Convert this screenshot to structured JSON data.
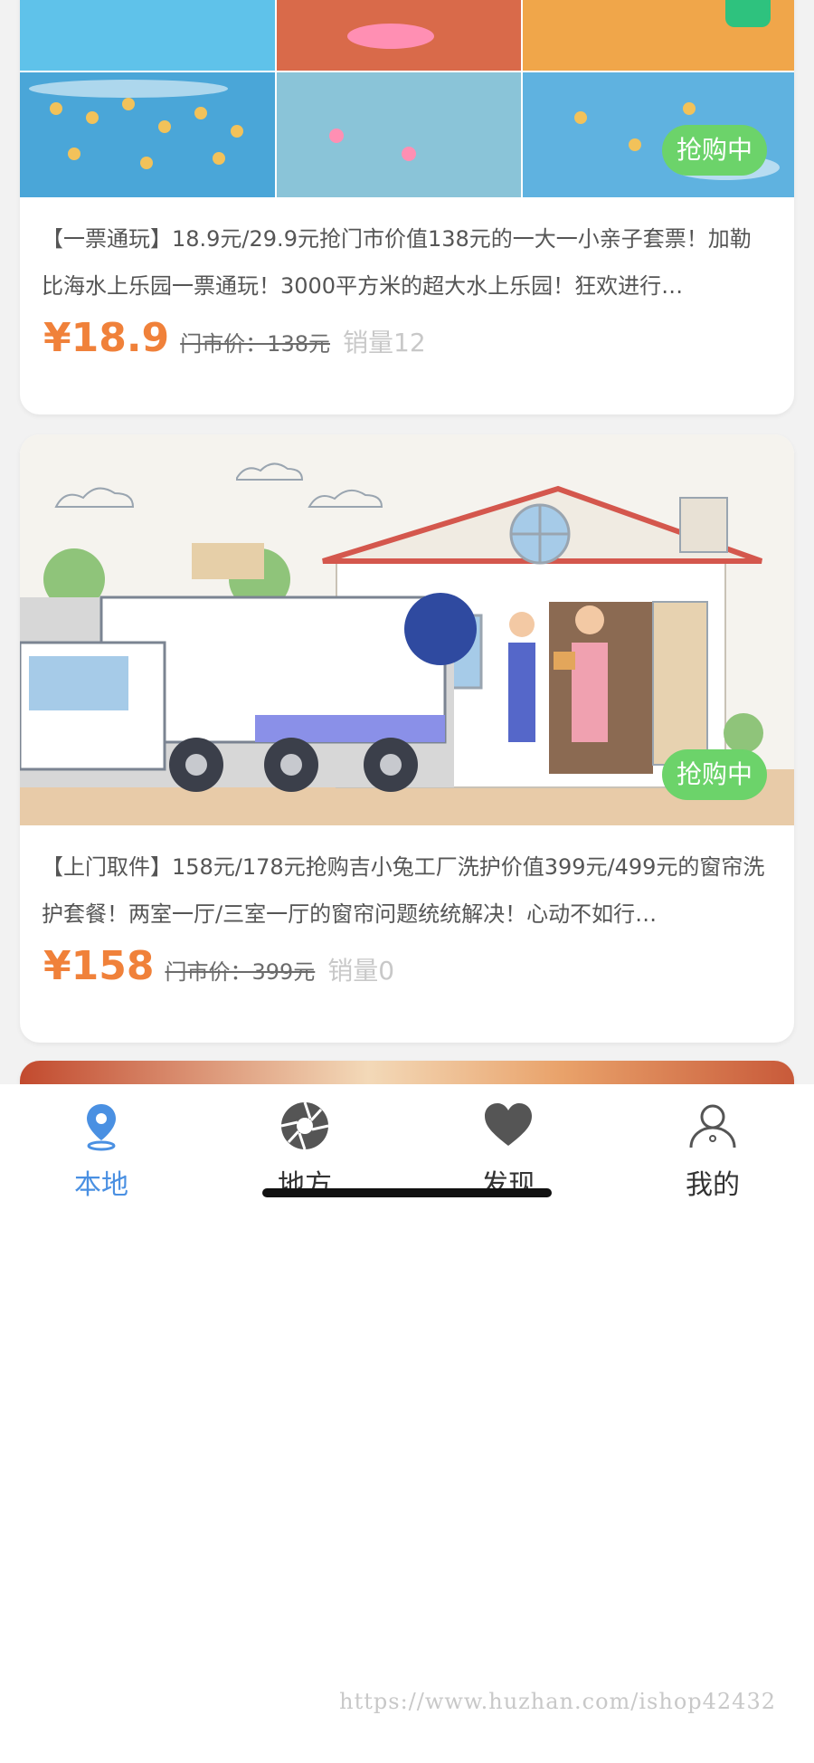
{
  "listings": [
    {
      "description": "【一票通玩】18.9元/29.9元抢门市价值138元的一大一小亲子套票！加勒比海水上乐园一票通玩！3000平方米的超大水上乐园！狂欢进行…",
      "price": "¥18.9",
      "original_price": "门市价：138元",
      "sales": "销量12",
      "badge": "抢购中"
    },
    {
      "description": "【上门取件】158元/178元抢购吉小兔工厂洗护价值399元/499元的窗帘洗护套餐！两室一厅/三室一厅的窗帘问题统统解决！心动不如行…",
      "price": "¥158",
      "original_price": "门市价：399元",
      "sales": "销量0",
      "badge": "抢购中"
    }
  ],
  "tabs": [
    {
      "label": "本地",
      "icon": "location-pin-icon",
      "active": true
    },
    {
      "label": "地方",
      "icon": "aperture-icon",
      "active": false
    },
    {
      "label": "发现",
      "icon": "heart-icon",
      "active": false
    },
    {
      "label": "我的",
      "icon": "user-icon",
      "active": false
    }
  ],
  "watermark": "https://www.huzhan.com/ishop42432",
  "colors": {
    "accent_blue": "#4a90e2",
    "price_orange": "#f0813a",
    "badge_green": "#6cd36a"
  }
}
